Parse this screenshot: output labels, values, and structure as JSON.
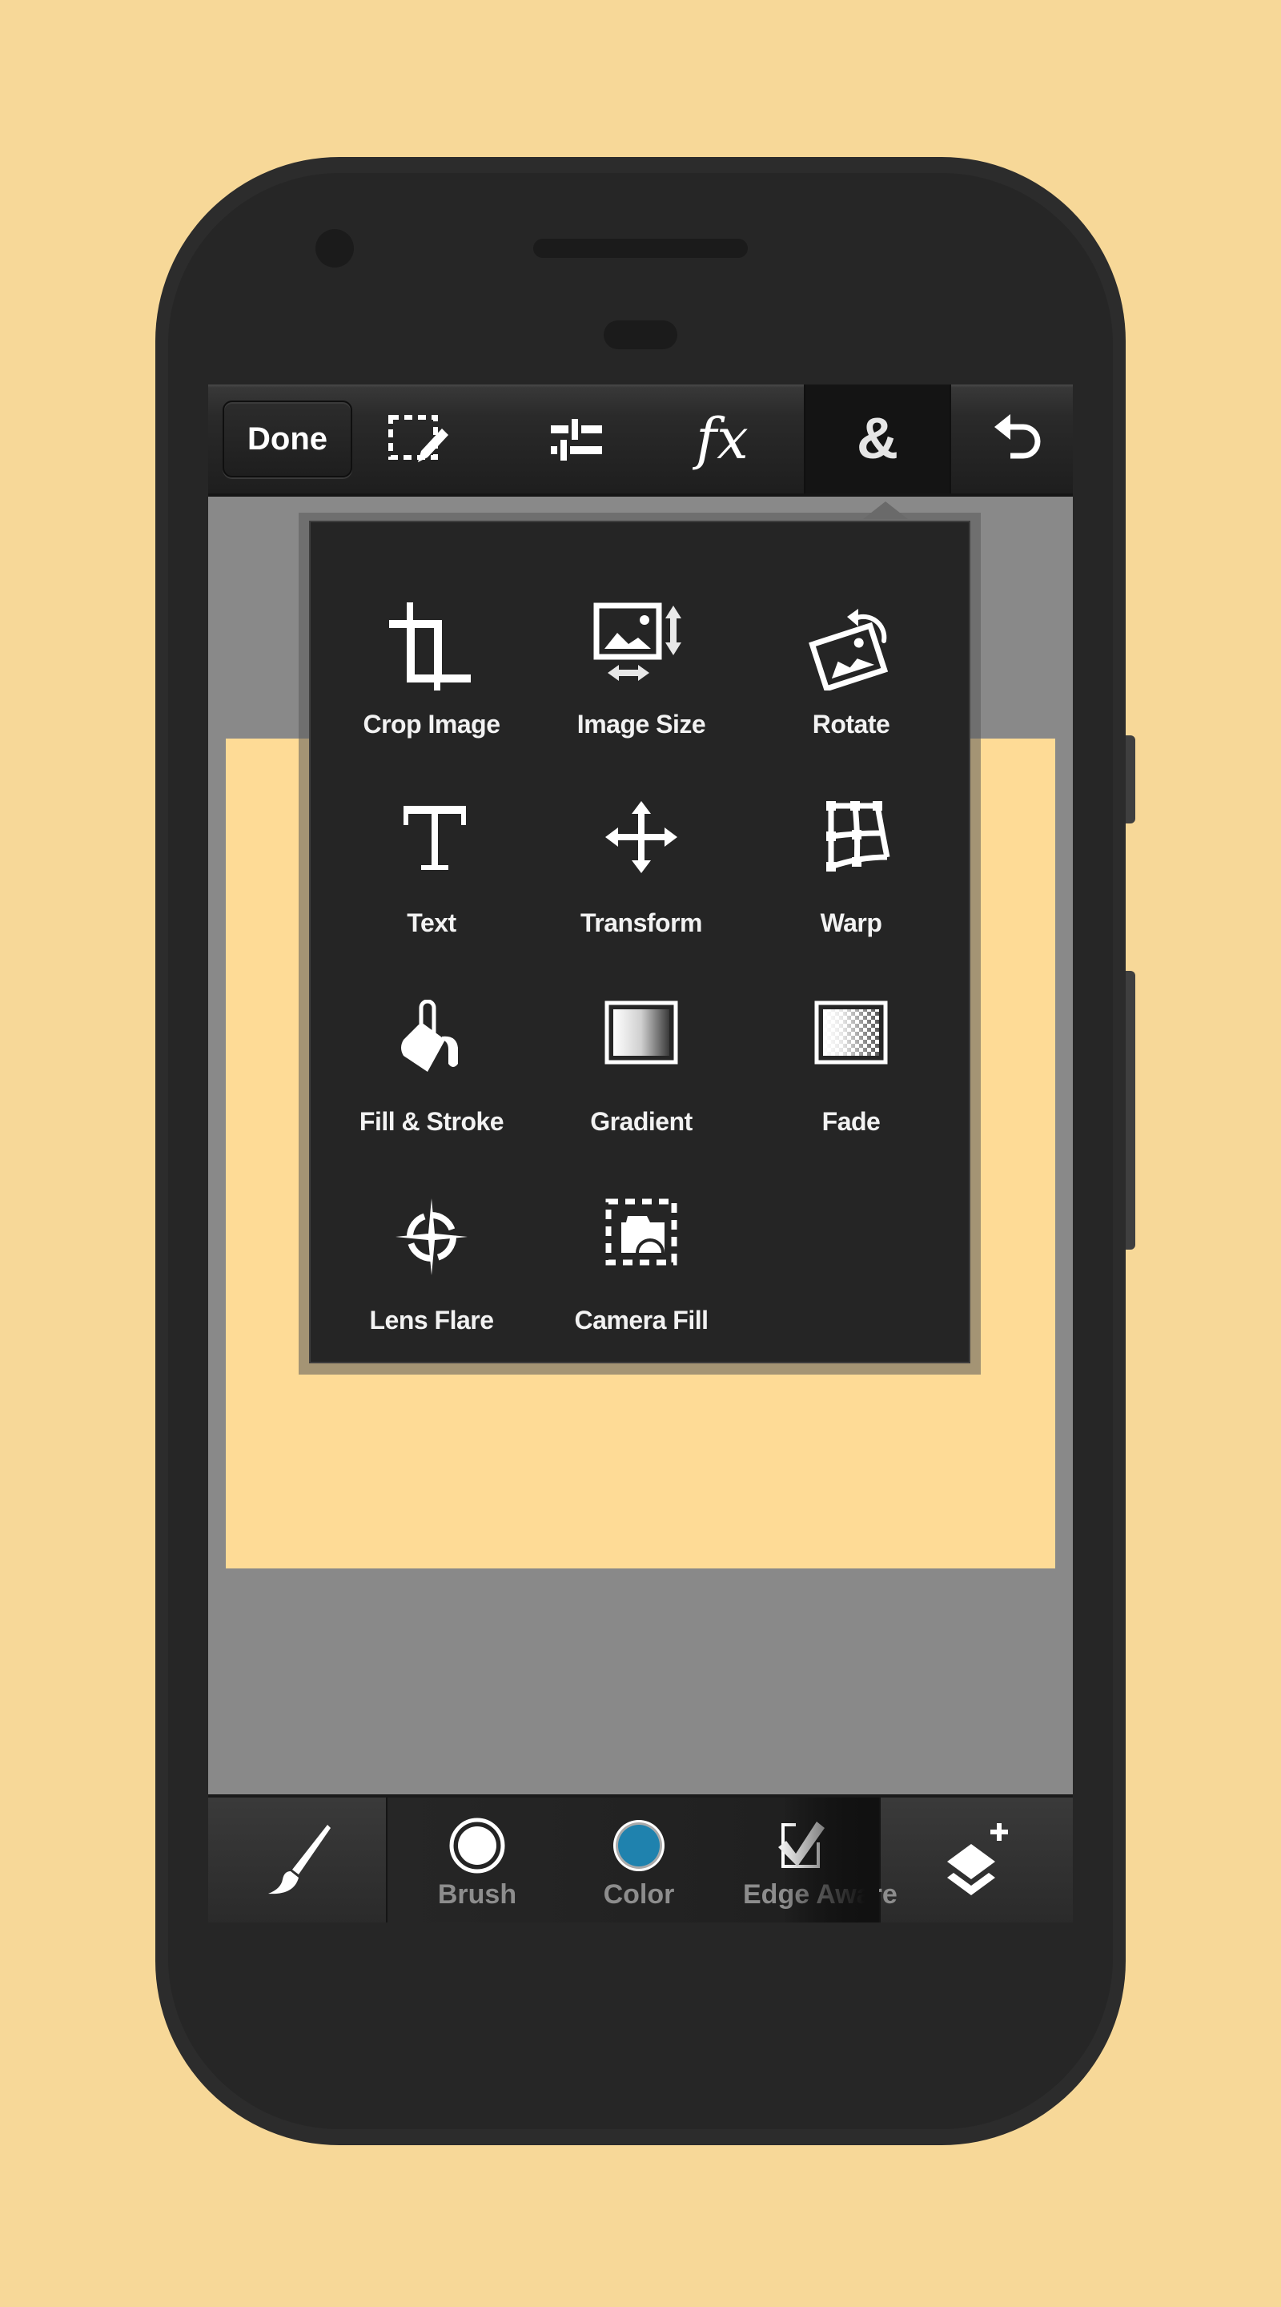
{
  "colors": {
    "background": "#f7d898",
    "phone_body": "#2c2c2c",
    "canvas": "#fedb96",
    "workspace": "#898989",
    "popup": "#252525",
    "color_swatch": "#1f82ae"
  },
  "toolbar": {
    "done_label": "Done",
    "items": [
      {
        "name": "selection-edit",
        "icon": "dashed-selection-pencil-icon"
      },
      {
        "name": "adjustments",
        "icon": "sliders-icon"
      },
      {
        "name": "effects",
        "icon": "fx-icon",
        "glyph": "fx"
      },
      {
        "name": "extras",
        "icon": "ampersand-icon",
        "glyph": "&",
        "active": true
      },
      {
        "name": "undo",
        "icon": "undo-icon"
      }
    ]
  },
  "menu": {
    "items": [
      {
        "label": "Crop Image",
        "icon": "crop-icon"
      },
      {
        "label": "Image Size",
        "icon": "image-size-icon"
      },
      {
        "label": "Rotate",
        "icon": "rotate-image-icon"
      },
      {
        "label": "Text",
        "icon": "text-icon"
      },
      {
        "label": "Transform",
        "icon": "move-arrows-icon"
      },
      {
        "label": "Warp",
        "icon": "warp-grid-icon"
      },
      {
        "label": "Fill & Stroke",
        "icon": "paint-bucket-icon"
      },
      {
        "label": "Gradient",
        "icon": "gradient-icon"
      },
      {
        "label": "Fade",
        "icon": "fade-icon"
      },
      {
        "label": "Lens Flare",
        "icon": "lens-flare-icon"
      },
      {
        "label": "Camera Fill",
        "icon": "camera-fill-icon"
      }
    ]
  },
  "bottombar": {
    "tool_icon": "brush-icon",
    "options": [
      {
        "label": "Brush",
        "icon": "brush-size-icon"
      },
      {
        "label": "Color",
        "icon": "color-swatch-icon"
      },
      {
        "label": "Edge Aware",
        "icon": "checkbox-checked-icon",
        "checked": true
      }
    ],
    "layers_icon": "add-layer-icon"
  }
}
